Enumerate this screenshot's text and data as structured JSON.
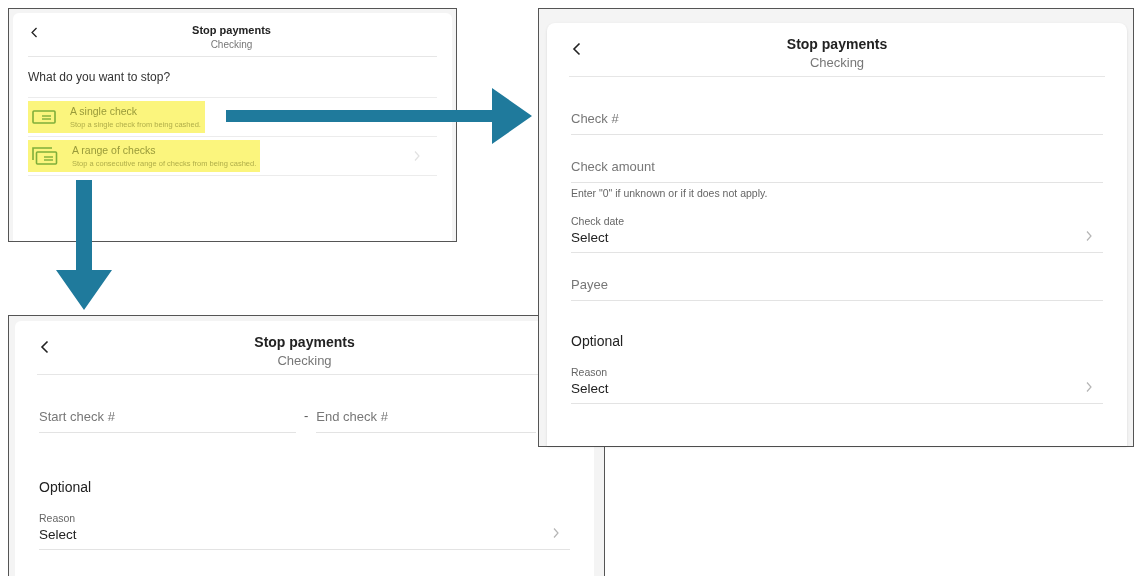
{
  "option_screen": {
    "header": {
      "title": "Stop payments",
      "subtitle": "Checking"
    },
    "question": "What do you want to stop?",
    "options": [
      {
        "kind": "single",
        "title": "A single check",
        "description": "Stop a single check from being cashed.",
        "highlighted": true
      },
      {
        "kind": "range",
        "title": "A range of checks",
        "description": "Stop a consecutive range of checks from being cashed.",
        "highlighted": true
      }
    ]
  },
  "single_check_screen": {
    "header": {
      "title": "Stop payments",
      "subtitle": "Checking"
    },
    "fields": [
      {
        "kind": "text",
        "placeholder": "Check #"
      },
      {
        "kind": "text",
        "placeholder": "Check amount",
        "hint": "Enter \"0\" if unknown or if it does not apply."
      },
      {
        "kind": "select",
        "label": "Check date",
        "value": "Select"
      },
      {
        "kind": "text",
        "placeholder": "Payee"
      },
      {
        "kind": "section",
        "title": "Optional"
      },
      {
        "kind": "select",
        "label": "Reason",
        "value": "Select"
      }
    ]
  },
  "range_screen": {
    "header": {
      "title": "Stop payments",
      "subtitle": "Checking"
    },
    "range": {
      "start_placeholder": "Start check #",
      "separator": "-",
      "end_placeholder": "End check #"
    },
    "fields": [
      {
        "kind": "section",
        "title": "Optional"
      },
      {
        "kind": "select",
        "label": "Reason",
        "value": "Select"
      }
    ]
  }
}
